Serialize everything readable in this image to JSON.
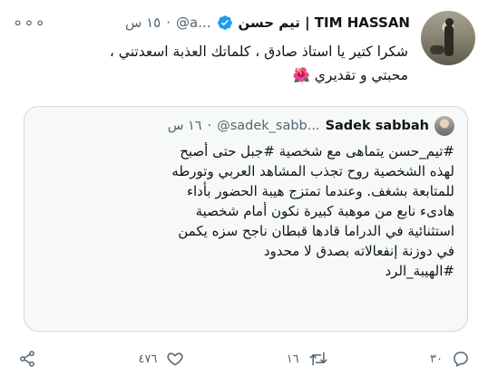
{
  "author": {
    "name": "تيم حسن | TIM HASSAN",
    "handle": "@a...",
    "time": "١٥ س",
    "more_label": "∘∘∘"
  },
  "tweet": {
    "lines": [
      "شكرا كتير يا استاذ صادق ، كلماتك العذبة اسعدتني ،",
      "محبتي و تقديري 🌺"
    ]
  },
  "quoted": {
    "name": "Sadek sabbah",
    "handle": "@sadek_sabb...",
    "time": "١٦ س",
    "lines": [
      "#تيم_حسن يتماهى مع شخصية #جبل حتى أصبح",
      "لهذه الشخصية روح تجذب المشاهد العربي وتورطه",
      "للمتابعة بشغف. وعندما تمتزج هيبة الحضور بأداء",
      "هادىء نابع من موهبة كبيرة نكون أمام شخصية",
      "استثنائية في الدراما قادها قبطان ناجح سزه يكمن",
      "في دوزنة إنفعالاته بصدق لا محدود",
      "#الهيبة_الرد"
    ]
  },
  "actions": {
    "share_icon": "share-icon",
    "like_count": "٤٧٦",
    "retweet_count": "١٦",
    "reply_count": "٣٠"
  },
  "colors": {
    "verified": "#1d9bf0",
    "muted": "#536471",
    "border": "#cfd9de"
  }
}
